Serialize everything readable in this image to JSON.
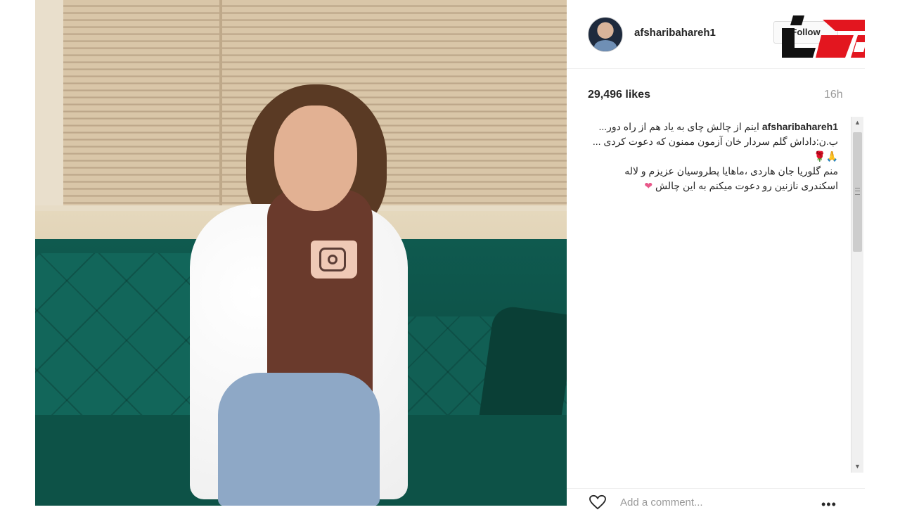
{
  "post": {
    "username": "afsharibahareh1",
    "follow_label": "Follow",
    "likes": "29,496 likes",
    "time": "16h",
    "caption_username": "afsharibahareh1",
    "caption_line1": "اینم از چالش چای به یاد هم از راه دور...",
    "caption_line2": "ب.ن:داداش گلم سردار خان آزمون ممنون که دعوت کردی ...",
    "caption_line3": "منم گلوریا جان هاردی ،ماهایا پطروسیان عزیزم و لاله اسکندری نازنین رو دعوت میکنم به این چالش",
    "add_comment_placeholder": "Add a comment...",
    "more_label": "•••"
  },
  "icons": {
    "avatar": "profile-photo",
    "like": "heart-outline-icon",
    "more": "more-options-icon",
    "logo": "news-site-logo",
    "scroll_up": "▲",
    "scroll_down": "▼"
  },
  "colors": {
    "logo_red": "#e3161f",
    "logo_black": "#111111",
    "muted_text": "#999999",
    "primary_text": "#262626"
  }
}
